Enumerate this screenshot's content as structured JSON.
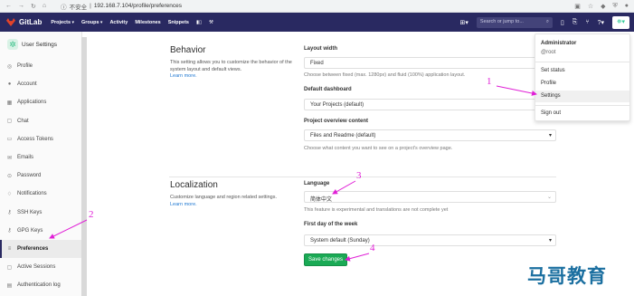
{
  "browser": {
    "security_label": "不安全",
    "url": "192.168.7.104/profile/preferences"
  },
  "topnav": {
    "brand": "GitLab",
    "menu": [
      {
        "label": "Projects",
        "dropdown": true
      },
      {
        "label": "Groups",
        "dropdown": true
      },
      {
        "label": "Activity",
        "dropdown": false
      },
      {
        "label": "Milestones",
        "dropdown": false
      },
      {
        "label": "Snippets",
        "dropdown": false
      }
    ],
    "search_placeholder": "Search or jump to..."
  },
  "sidebar": {
    "title": "User Settings",
    "items": [
      {
        "label": "Profile",
        "icon": "user-icon",
        "glyph": "◎"
      },
      {
        "label": "Account",
        "icon": "account-icon",
        "glyph": "●"
      },
      {
        "label": "Applications",
        "icon": "applications-icon",
        "glyph": "▦"
      },
      {
        "label": "Chat",
        "icon": "chat-icon",
        "glyph": "▢"
      },
      {
        "label": "Access Tokens",
        "icon": "key-icon",
        "glyph": "▭"
      },
      {
        "label": "Emails",
        "icon": "mail-icon",
        "glyph": "✉"
      },
      {
        "label": "Password",
        "icon": "lock-icon",
        "glyph": "⊙"
      },
      {
        "label": "Notifications",
        "icon": "bell-icon",
        "glyph": "♢"
      },
      {
        "label": "SSH Keys",
        "icon": "ssh-key-icon",
        "glyph": "⚷"
      },
      {
        "label": "GPG Keys",
        "icon": "gpg-key-icon",
        "glyph": "⚷"
      },
      {
        "label": "Preferences",
        "icon": "preferences-icon",
        "glyph": "≡",
        "active": true
      },
      {
        "label": "Active Sessions",
        "icon": "sessions-icon",
        "glyph": "▢"
      },
      {
        "label": "Authentication log",
        "icon": "log-icon",
        "glyph": "▤"
      }
    ]
  },
  "behavior": {
    "title": "Behavior",
    "description": "This setting allows you to customize the behavior of the system layout and default views.",
    "learn_more": "Learn more.",
    "layout_width_label": "Layout width",
    "layout_width_value": "Fixed",
    "layout_width_help": "Choose between fixed (max. 1280px) and fluid (100%) application layout.",
    "default_dashboard_label": "Default dashboard",
    "default_dashboard_value": "Your Projects (default)",
    "project_overview_label": "Project overview content",
    "project_overview_value": "Files and Readme (default)",
    "project_overview_help": "Choose what content you want to see on a project's overview page."
  },
  "localization": {
    "title": "Localization",
    "description": "Customize language and region related settings.",
    "learn_more": "Learn more.",
    "language_label": "Language",
    "language_value": "简体中文",
    "language_help": "This feature is experimental and translations are not complete yet",
    "first_day_label": "First day of the week",
    "first_day_value": "System default (Sunday)"
  },
  "save_button": "Save changes",
  "user_dropdown": {
    "name": "Administrator",
    "username": "@root",
    "items": [
      "Set status",
      "Profile",
      "Settings",
      "Sign out"
    ]
  },
  "annotations": [
    "1",
    "2",
    "3",
    "4"
  ],
  "watermark": "马哥教育",
  "colors": {
    "navbar": "#292961",
    "save_button": "#1aaa55",
    "annotation": "#e020d6",
    "link": "#1f78d1"
  }
}
